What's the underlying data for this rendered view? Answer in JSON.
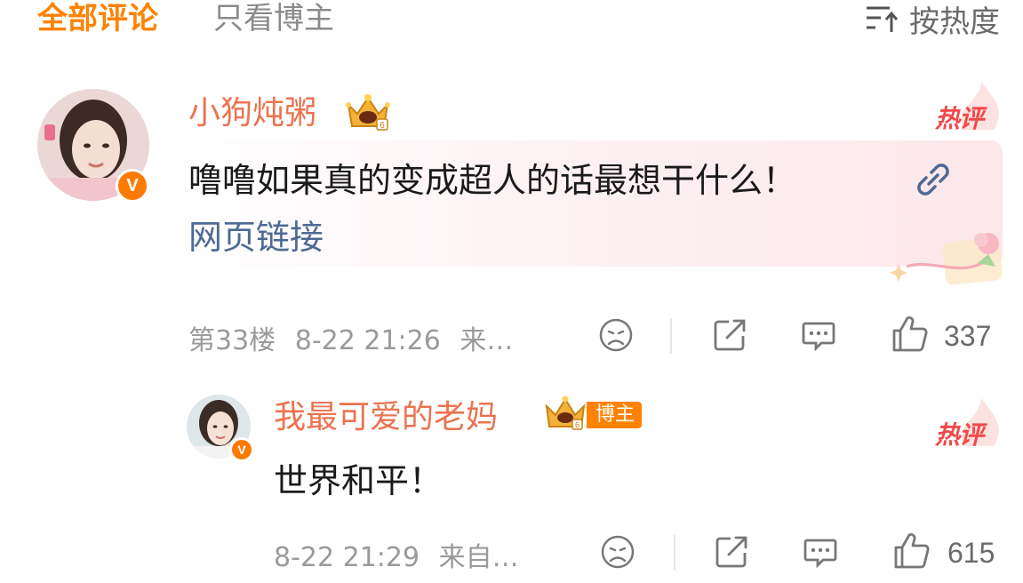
{
  "tabs": {
    "all": "全部评论",
    "author_only": "只看博主"
  },
  "sort": {
    "label": "按热度",
    "icon": "sort-icon"
  },
  "comments": [
    {
      "username": "小狗炖粥",
      "badge": "hot-comment",
      "hot_label": "热评",
      "text": "噜噜如果真的变成超人的话最想干什么！",
      "link_label": "网页链接",
      "floor": "第33楼",
      "time": "8-22 21:26",
      "source": "来…",
      "likes": "337"
    },
    {
      "username": "我最可爱的老妈",
      "author_tag": "博主",
      "hot_label": "热评",
      "text": "世界和平！",
      "time": "8-22 21:29",
      "source": "来自…",
      "likes": "615"
    }
  ],
  "colors": {
    "accent": "#ff8200",
    "username": "#eb7350",
    "hot": "#f04a4a",
    "link": "#4d6a94",
    "meta": "#9a9a9a"
  }
}
